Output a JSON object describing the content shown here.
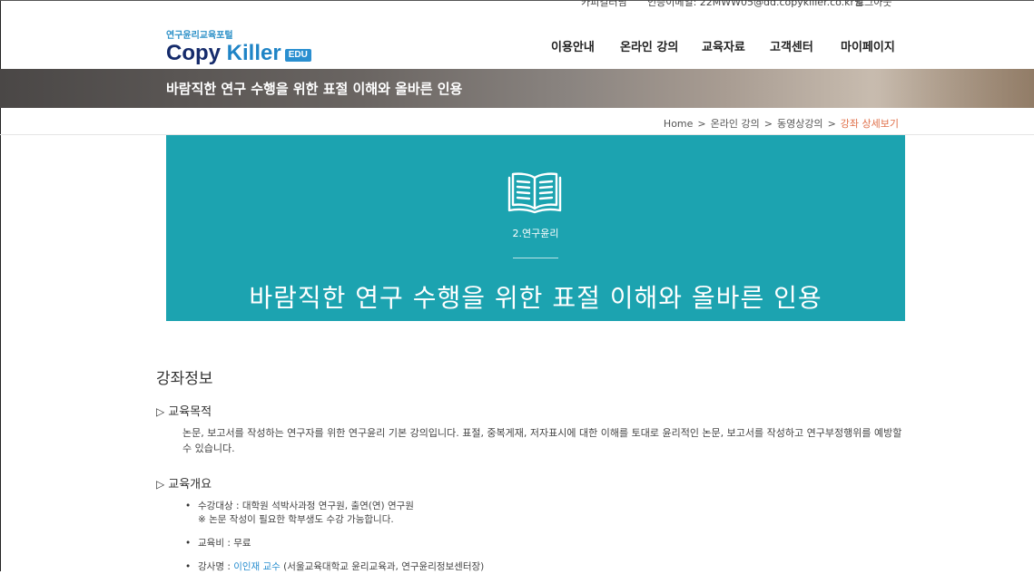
{
  "topbar": {
    "item1": "카피킬러님",
    "item2": "인증이메일: 22MWW05@dd.copykiller.co.kr님",
    "item3": "로그아웃"
  },
  "logo": {
    "sub": "연구윤리교육포털",
    "main_copy": "Copy ",
    "main_killer": "Killer",
    "badge": "EDU"
  },
  "nav": [
    "이용안내",
    "온라인 강의",
    "교육자료",
    "고객센터",
    "마이페이지"
  ],
  "banner": {
    "title": "바람직한 연구 수행을 위한 표절 이해와 올바른 인용"
  },
  "breadcrumb": {
    "items": [
      "Home",
      "온라인 강의",
      "동영상강의"
    ],
    "current": "강좌 상세보기",
    "separator": ">"
  },
  "hero": {
    "icon": "open-book-icon",
    "category": "2.연구윤리",
    "title": "바람직한 연구 수행을 위한 표절 이해와 올바른 인용",
    "bg_color": "#1ca3b0"
  },
  "course_info": {
    "section_title": "강좌정보",
    "purpose_heading": "교육목적",
    "purpose_text": "논문, 보고서를 작성하는 연구자를 위한 연구윤리 기본 강의입니다. 표절, 중복게재, 저자표시에 대한 이해를 토대로 윤리적인 논문, 보고서를 작성하고 연구부정행위를 예방할 수 있습니다.",
    "overview_heading": "교육개요",
    "target_label": "수강대상 : 대학원 석박사과정 연구원, 출연(연) 연구원",
    "target_note": "※ 논문 작성이 필요한 학부생도 수강 가능합니다.",
    "fee_label": "교육비 : 무료",
    "instructor_prefix": "강사명 : ",
    "instructor_name": "이인재 교수",
    "instructor_affil": " (서울교육대학교 윤리교육과, 연구윤리정보센터장)"
  }
}
